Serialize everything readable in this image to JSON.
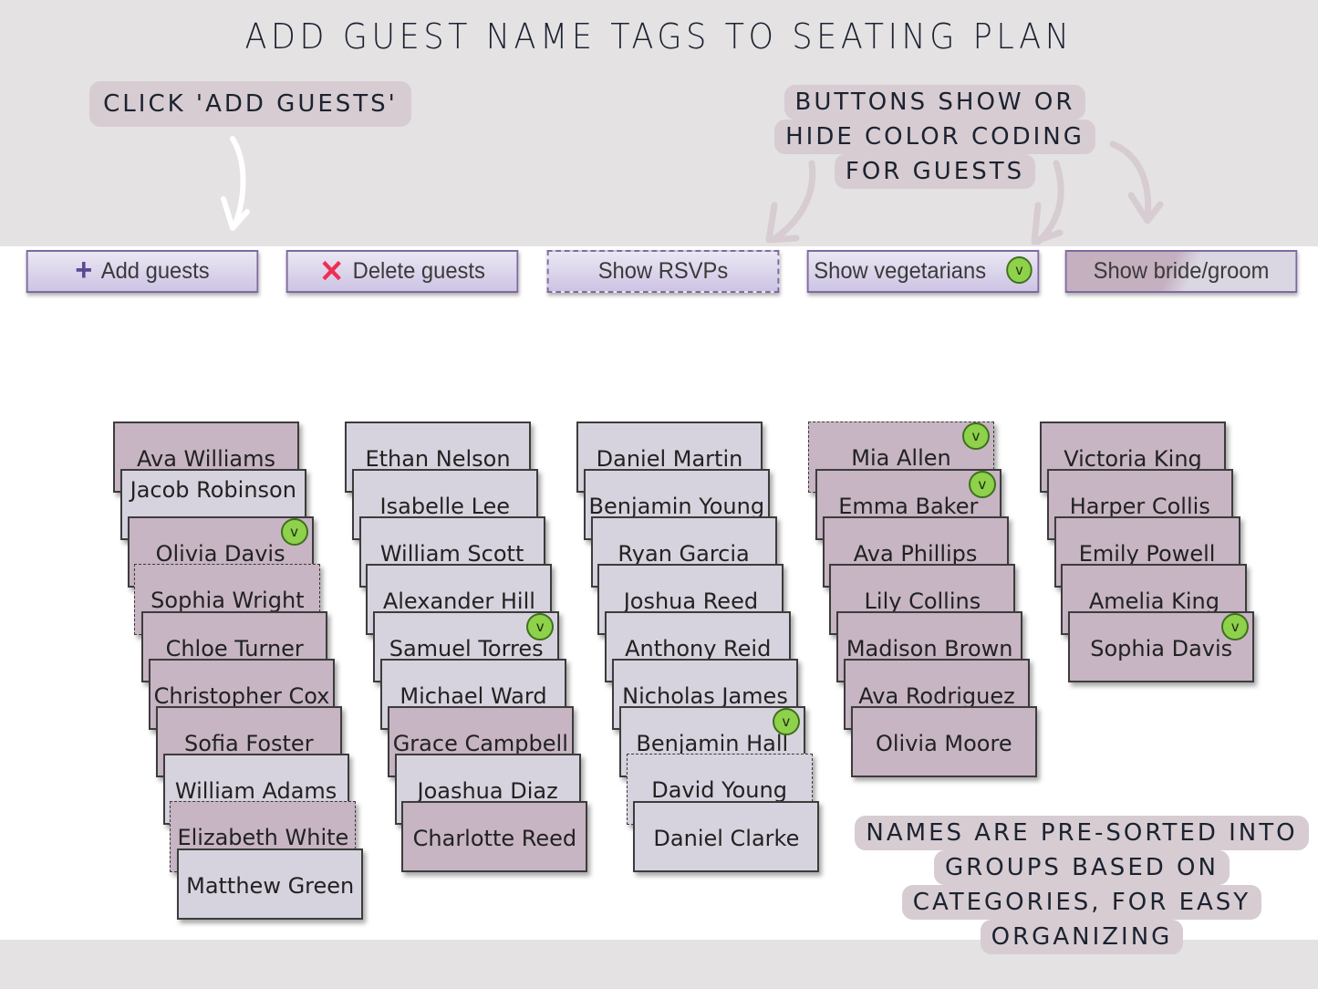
{
  "title": "ADD GUEST NAME TAGS TO SEATING PLAN",
  "callouts": {
    "add": "CLICK 'ADD GUESTS'",
    "buttons": [
      "BUTTONS SHOW OR",
      "HIDE COLOR CODING",
      "FOR GUESTS"
    ],
    "sorted": [
      "NAMES ARE PRE-SORTED INTO",
      "GROUPS BASED ON",
      "CATEGORIES, FOR EASY",
      "ORGANIZING"
    ]
  },
  "toolbar": {
    "add": {
      "label": "Add guests",
      "icon": "plus-icon"
    },
    "delete": {
      "label": "Delete guests",
      "icon": "x-icon"
    },
    "rsvp": {
      "label": "Show RSVPs"
    },
    "vegetarian": {
      "label": "Show vegetarians",
      "badge": "v"
    },
    "bride_groom": {
      "label": "Show bride/groom"
    }
  },
  "colors": {
    "bride_side": "#c7b5c3",
    "groom_side": "#d7d3de",
    "veg_badge": "#8ed14a",
    "button_border": "#7e6aa0",
    "delete_icon": "#ee2f55",
    "add_icon": "#5b4a92",
    "callout_bg": "#d6ccd2",
    "band_bg": "#e4e2e3"
  },
  "groups": [
    [
      {
        "name": "Ava Williams",
        "side": "bride"
      },
      {
        "name": "Jacob Robinson",
        "side": "groom",
        "wrap": true
      },
      {
        "name": "Olivia Davis",
        "side": "bride",
        "veg": true
      },
      {
        "name": "Sophia Wright",
        "side": "bride",
        "unrsvp": true
      },
      {
        "name": "Chloe Turner",
        "side": "bride"
      },
      {
        "name": "Christopher Cox",
        "side": "bride"
      },
      {
        "name": "Sofia Foster",
        "side": "bride"
      },
      {
        "name": "William Adams",
        "side": "groom"
      },
      {
        "name": "Elizabeth White",
        "side": "bride",
        "unrsvp": true
      },
      {
        "name": "Matthew Green",
        "side": "groom"
      }
    ],
    [
      {
        "name": "Ethan Nelson",
        "side": "groom"
      },
      {
        "name": "Isabelle Lee",
        "side": "groom"
      },
      {
        "name": "William Scott",
        "side": "groom"
      },
      {
        "name": "Alexander Hill",
        "side": "groom"
      },
      {
        "name": "Samuel Torres",
        "side": "groom",
        "veg": true
      },
      {
        "name": "Michael Ward",
        "side": "groom"
      },
      {
        "name": "Grace Campbell",
        "side": "bride"
      },
      {
        "name": "Joashua Diaz",
        "side": "groom"
      },
      {
        "name": "Charlotte Reed",
        "side": "bride"
      }
    ],
    [
      {
        "name": "Daniel Martin",
        "side": "groom"
      },
      {
        "name": "Benjamin Young",
        "side": "groom"
      },
      {
        "name": "Ryan Garcia",
        "side": "groom"
      },
      {
        "name": "Joshua Reed",
        "side": "groom"
      },
      {
        "name": "Anthony Reid",
        "side": "groom"
      },
      {
        "name": "Nicholas James",
        "side": "groom"
      },
      {
        "name": "Benjamin Hall",
        "side": "groom",
        "veg": true
      },
      {
        "name": "David Young",
        "side": "groom",
        "unrsvp": true
      },
      {
        "name": "Daniel Clarke",
        "side": "groom"
      }
    ],
    [
      {
        "name": "Mia Allen",
        "side": "bride",
        "veg": true,
        "unrsvp": true
      },
      {
        "name": "Emma Baker",
        "side": "bride",
        "veg": true
      },
      {
        "name": "Ava Phillips",
        "side": "bride"
      },
      {
        "name": "Lily Collins",
        "side": "bride"
      },
      {
        "name": "Madison Brown",
        "side": "bride"
      },
      {
        "name": "Ava Rodriguez",
        "side": "bride"
      },
      {
        "name": "Olivia Moore",
        "side": "bride"
      }
    ],
    [
      {
        "name": "Victoria King",
        "side": "bride"
      },
      {
        "name": "Harper Collis",
        "side": "bride"
      },
      {
        "name": "Emily Powell",
        "side": "bride"
      },
      {
        "name": "Amelia King",
        "side": "bride"
      },
      {
        "name": "Sophia Davis",
        "side": "bride",
        "veg": true
      }
    ]
  ]
}
